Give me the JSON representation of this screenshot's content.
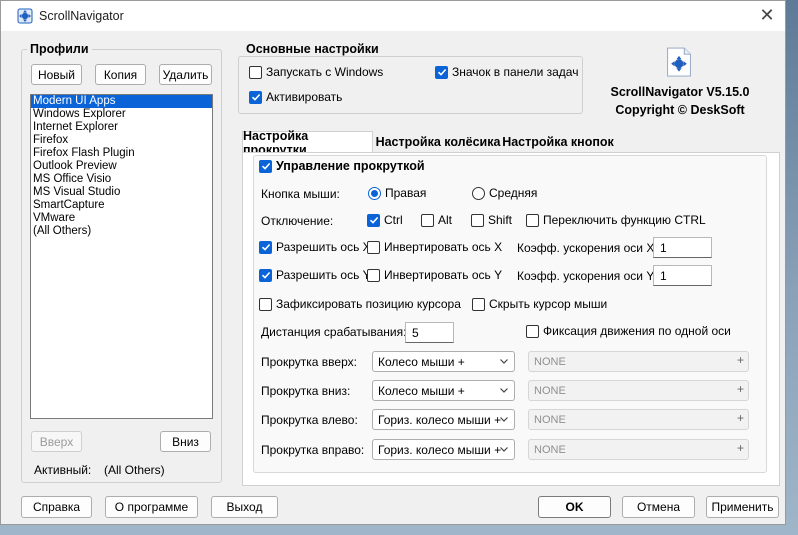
{
  "window": {
    "title": "ScrollNavigator"
  },
  "profiles": {
    "group_label": "Профили",
    "new_label": "Новый",
    "copy_label": "Копия",
    "delete_label": "Удалить",
    "items": [
      "Modern UI Apps",
      "Windows Explorer",
      "Internet Explorer",
      "Firefox",
      "Firefox Flash Plugin",
      "Outlook Preview",
      "MS Office Visio",
      "MS Visual Studio",
      "SmartCapture",
      "VMware",
      "(All Others)"
    ],
    "selected_index": 0,
    "up_label": "Вверх",
    "down_label": "Вниз",
    "active_label": "Активный:",
    "active_value": "(All Others)"
  },
  "basic": {
    "group_label": "Основные настройки",
    "run_windows": "Запускать с Windows",
    "run_windows_checked": false,
    "tray_icon": "Значок в панели задач",
    "tray_icon_checked": true,
    "activate": "Активировать",
    "activate_checked": true
  },
  "about": {
    "version": "ScrollNavigator V5.15.0",
    "copyright": "Copyright © DeskSoft"
  },
  "tabs": [
    {
      "label": "Настройка прокрутки",
      "active": true
    },
    {
      "label": "Настройка колёсика",
      "active": false
    },
    {
      "label": "Настройка кнопок",
      "active": false
    }
  ],
  "scroll": {
    "group_label": "Управление прокруткой",
    "group_checked": true,
    "mouse_button_label": "Кнопка мыши:",
    "right_label": "Правая",
    "middle_label": "Средняя",
    "selected_button": "right",
    "disable_label": "Отключение:",
    "ctrl_label": "Ctrl",
    "alt_label": "Alt",
    "shift_label": "Shift",
    "toggle_ctrl_label": "Переключить функцию CTRL",
    "allow_x_label": "Разрешить ось X",
    "invert_x_label": "Инвертировать ось X",
    "accel_x_label": "Коэфф. ускорения оси X",
    "accel_x_value": "1",
    "allow_y_label": "Разрешить ось Y",
    "invert_y_label": "Инвертировать ось Y",
    "accel_y_label": "Коэфф. ускорения оси Y",
    "accel_y_value": "1",
    "fix_cursor_label": "Зафиксировать позицию курсора",
    "hide_cursor_label": "Скрыть курсор мыши",
    "distance_label": "Дистанция срабатывания:",
    "distance_value": "5",
    "one_axis_label": "Фиксация движения по одной оси",
    "scroll_up_label": "Прокрутка вверх:",
    "scroll_up_value": "Колесо мыши +",
    "scroll_down_label": "Прокрутка вниз:",
    "scroll_down_value": "Колесо мыши +",
    "scroll_left_label": "Прокрутка влево:",
    "scroll_left_value": "Гориз. колесо мыши +",
    "scroll_right_label": "Прокрутка вправо:",
    "scroll_right_value": "Гориз. колесо мыши +",
    "none_value": "NONE",
    "plus": "+"
  },
  "footer": {
    "help_label": "Справка",
    "about_label": "О программе",
    "exit_label": "Выход",
    "ok_label": "OK",
    "cancel_label": "Отмена",
    "apply_label": "Применить"
  },
  "colors": {
    "accent": "#0a64d8",
    "window_bg": "#f0f0f0"
  }
}
